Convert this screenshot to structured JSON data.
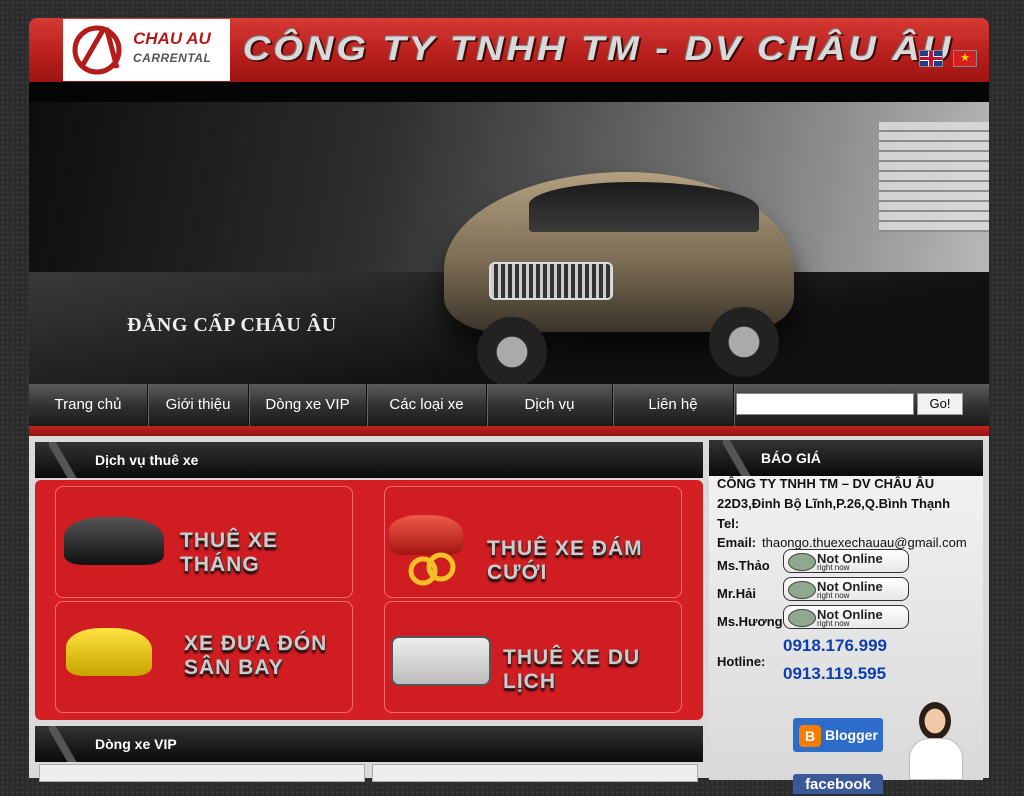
{
  "header": {
    "logo_main": "CHAU AU",
    "logo_sub": "CARRENTAL",
    "company_name": "CÔNG TY TNHH TM - DV CHÂU ÂU",
    "languages": [
      "en-flag-icon",
      "vn-flag-icon"
    ]
  },
  "banner": {
    "slogan": "ĐẲNG CẤP CHÂU ÂU"
  },
  "nav": {
    "items": [
      {
        "label": "Trang chủ"
      },
      {
        "label": "Giới thiệu"
      },
      {
        "label": "Dòng xe VIP"
      },
      {
        "label": "Các loại xe"
      },
      {
        "label": "Dịch vụ"
      },
      {
        "label": "Liên hệ"
      }
    ],
    "search_value": "",
    "go_label": "Go!"
  },
  "services": {
    "title": "Dịch vụ thuê xe",
    "cards": [
      {
        "title": "THUÊ XE THÁNG"
      },
      {
        "title": "THUÊ XE ĐÁM CƯỚI"
      },
      {
        "title": "XE ĐƯA ĐÓN SÂN BAY"
      },
      {
        "title": "THUÊ XE DU LỊCH"
      }
    ]
  },
  "vip": {
    "title": "Dòng xe VIP"
  },
  "sidebar": {
    "title": "BÁO GIÁ",
    "company": "CÔNG TY TNHH TM – DV CHÂU ÂU",
    "address": "22D3,Đinh Bộ Lĩnh,P.26,Q.Bình Thạnh",
    "tel_label": "Tel:",
    "email_label": "Email:",
    "email_value": "thaongo.thuexechauau@gmail.com",
    "contacts": [
      {
        "name": "Ms.Thảo",
        "status": "Not Online",
        "status_sub": "right now"
      },
      {
        "name": "Mr.Hải",
        "status": "Not Online",
        "status_sub": "right now"
      },
      {
        "name": "Ms.Hương",
        "status": "Not Online",
        "status_sub": "right now"
      }
    ],
    "hotline_label": "Hotline:",
    "hotlines": [
      "0918.176.999",
      "0913.119.595"
    ],
    "blogger_label": "Blogger",
    "facebook_label": "facebook"
  },
  "colors": {
    "brand_red": "#c9201e",
    "hotline_blue": "#0d3fb0"
  }
}
